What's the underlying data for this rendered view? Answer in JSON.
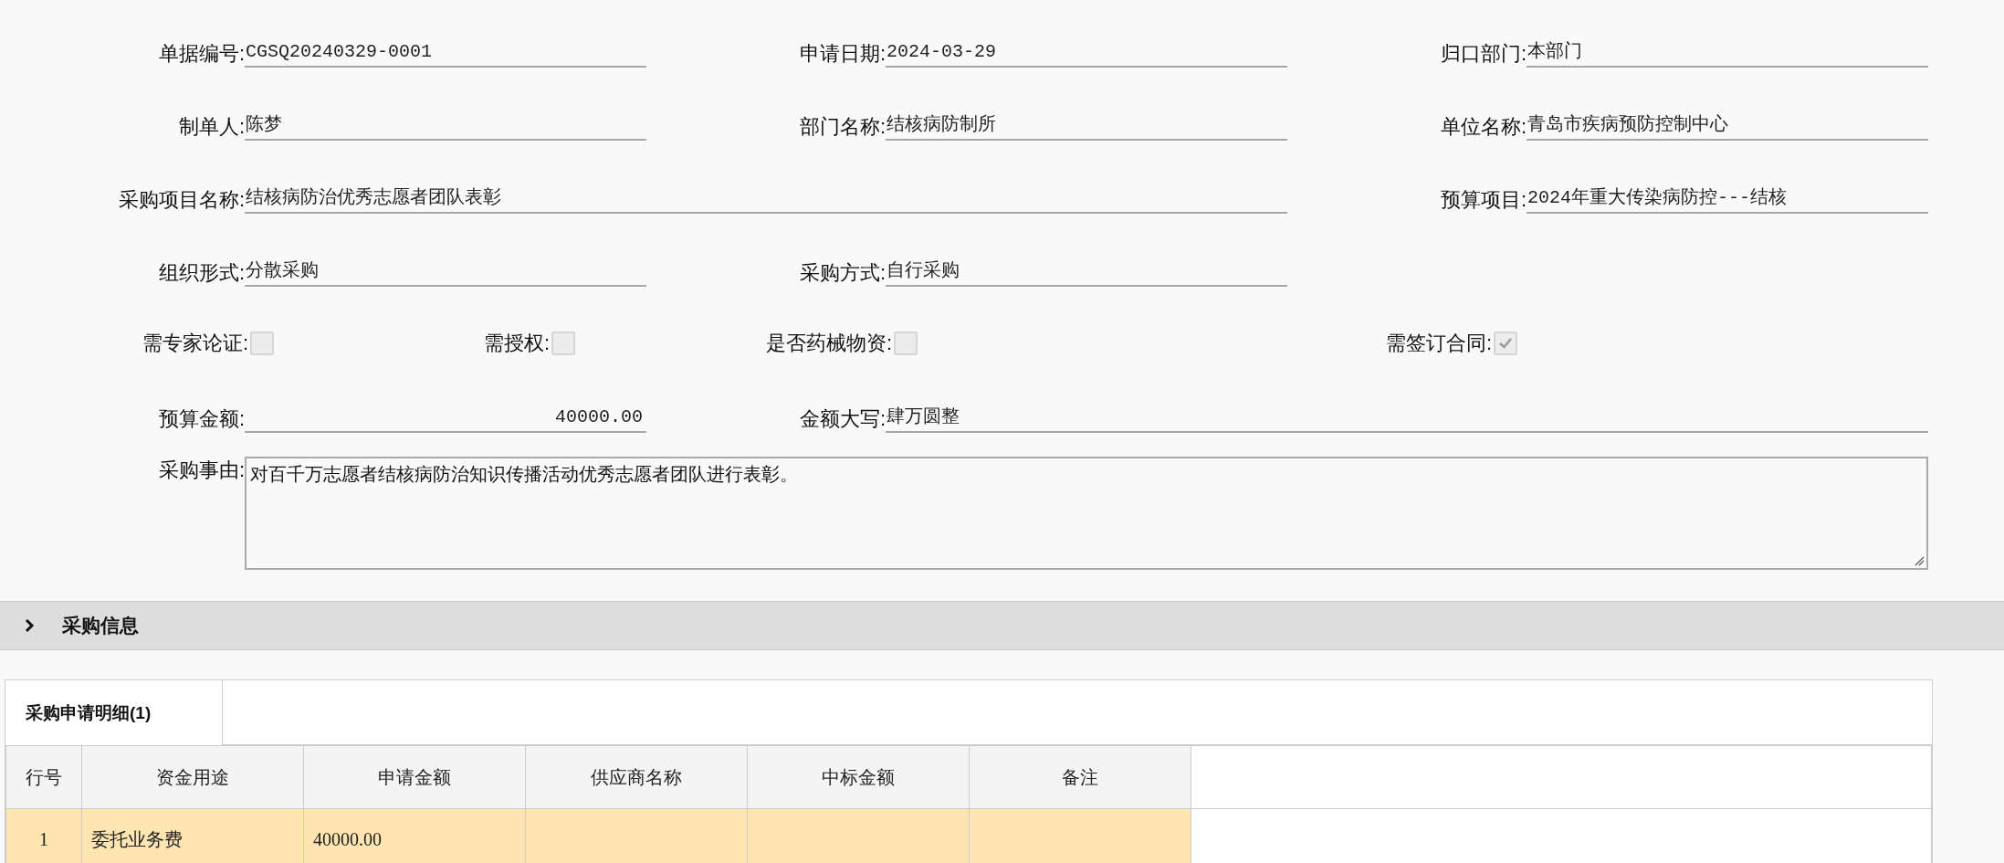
{
  "form_rows": [
    {
      "fields": [
        {
          "kind": "text",
          "label": "单据编号:",
          "value": "CGSQ20240329-0001"
        },
        {
          "kind": "text",
          "label": "申请日期:",
          "value": "2024-03-29"
        },
        {
          "kind": "text",
          "label": "归口部门:",
          "value": "本部门"
        }
      ]
    },
    {
      "fields": [
        {
          "kind": "text",
          "label": "制单人:",
          "value": "陈梦"
        },
        {
          "kind": "text",
          "label": "部门名称:",
          "value": "结核病防制所"
        },
        {
          "kind": "text",
          "label": "单位名称:",
          "value": "青岛市疾病预防控制中心"
        }
      ]
    },
    {
      "fields": [
        {
          "kind": "wide",
          "label": "采购项目名称:",
          "value": "结核病防治优秀志愿者团队表彰"
        },
        {
          "kind": "text",
          "label": "预算项目:",
          "value": "2024年重大传染病防控---结核"
        }
      ]
    },
    {
      "fields": [
        {
          "kind": "text",
          "label": "组织形式:",
          "value": "分散采购"
        },
        {
          "kind": "text",
          "label": "采购方式:",
          "value": "自行采购"
        }
      ]
    }
  ],
  "options": [
    {
      "label": "需专家论证:",
      "checked": false
    },
    {
      "label": "需授权:",
      "checked": false
    },
    {
      "label": "是否药械物资:",
      "checked": false
    },
    {
      "label": "需签订合同:",
      "checked": true
    }
  ],
  "amount_row": [
    {
      "kind": "number",
      "label": "预算金额:",
      "value": "40000.00"
    },
    {
      "kind": "wide2",
      "label": "金额大写:",
      "value": "肆万圆整"
    }
  ],
  "reason": {
    "label": "采购事由:",
    "value": "对百千万志愿者结核病防治知识传播活动优秀志愿者团队进行表彰。"
  },
  "section": {
    "title": "采购信息"
  },
  "tabs": [
    {
      "label": "采购申请明细(1)",
      "selected": true
    }
  ],
  "table": {
    "columns": [
      "行号",
      "资金用途",
      "申请金额",
      "供应商名称",
      "中标金额",
      "备注"
    ],
    "rows": [
      {
        "line": "1",
        "purpose": "委托业务费",
        "amount": "40000.00",
        "selected": true
      }
    ]
  }
}
